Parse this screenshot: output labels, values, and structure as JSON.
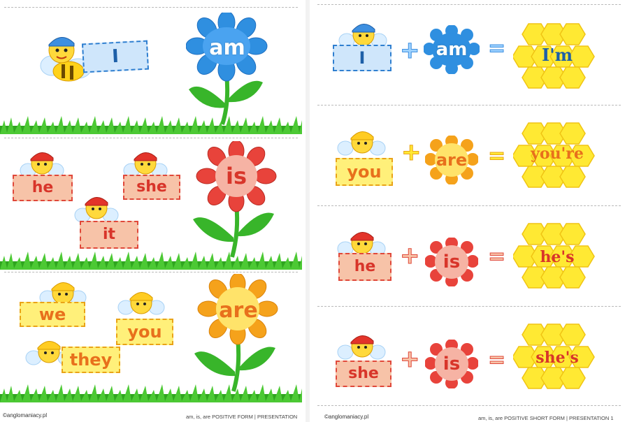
{
  "left": {
    "panel1": {
      "labels": [
        "I"
      ],
      "flower": "am"
    },
    "panel2": {
      "labels": [
        "he",
        "she",
        "it"
      ],
      "flower": "is"
    },
    "panel3": {
      "labels": [
        "we",
        "you",
        "they"
      ],
      "flower": "are"
    },
    "copyright": "anglomaniacy.pl",
    "footer": "am, is, are  POSITIVE FORM | PRESENTATION"
  },
  "right": {
    "rows": [
      {
        "pronoun": "I",
        "verb": "am",
        "result": "I'm"
      },
      {
        "pronoun": "you",
        "verb": "are",
        "result": "you're"
      },
      {
        "pronoun": "he",
        "verb": "is",
        "result": "he's"
      },
      {
        "pronoun": "she",
        "verb": "is",
        "result": "she's"
      }
    ],
    "copyright": "anglomaniacy.pl",
    "footer": "am, is, are  POSITIVE SHORT FORM | PRESENTATION 1"
  },
  "colors": {
    "blue": "#2f8fe0",
    "red": "#e8433b",
    "orange": "#f5a21b",
    "grass": "#3dbb2a",
    "honey": "#ffe933",
    "stem": "#38b52a"
  }
}
